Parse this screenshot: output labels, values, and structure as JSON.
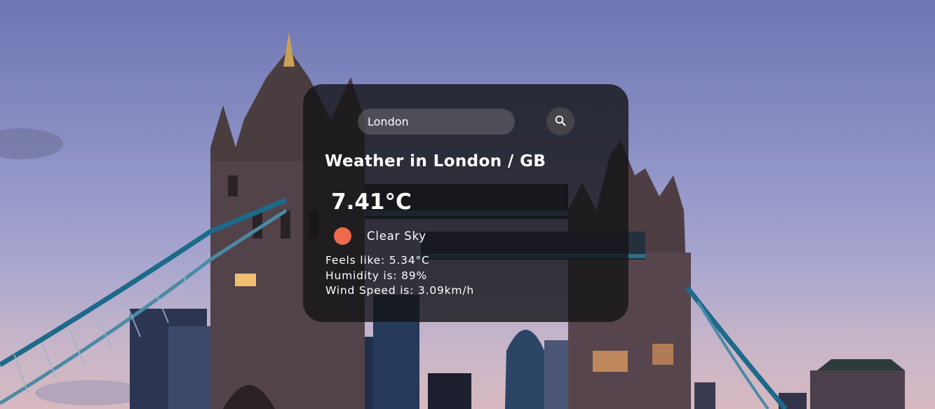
{
  "search": {
    "value": "London",
    "icon": "search-icon"
  },
  "weather": {
    "title": "Weather in London / GB",
    "temperature": "7.41°C",
    "description": "Clear Sky",
    "icon_color": "#ef6a4b",
    "feels_like": "Feels like: 5.34°C",
    "humidity": "Humidity is: 89%",
    "wind_speed": "Wind Speed is: 3.09km/h"
  },
  "colors": {
    "card_background": "rgba(20,20,22,0.80)",
    "text": "#ffffff"
  }
}
